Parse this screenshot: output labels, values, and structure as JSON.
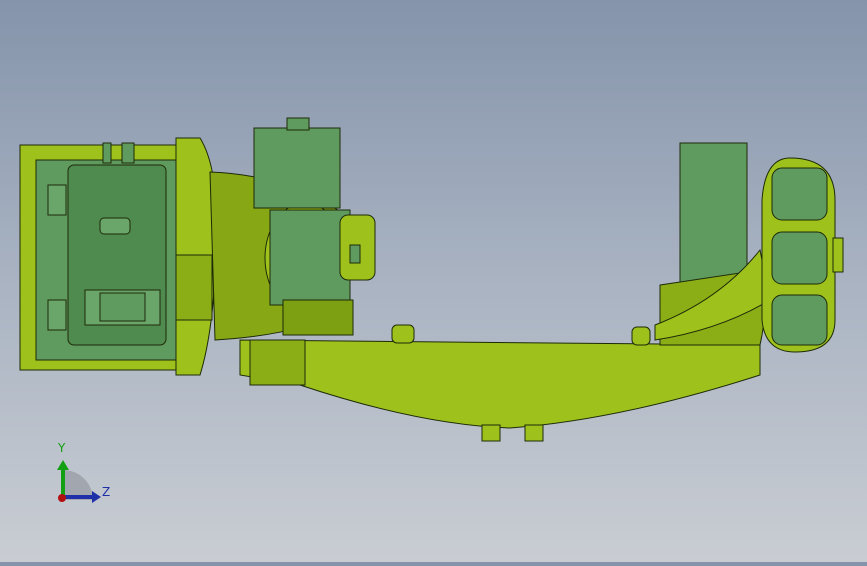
{
  "triad": {
    "y_label": "Y",
    "z_label": "Z"
  },
  "colors": {
    "body": "#9ec11c",
    "body_dark": "#6d8a12",
    "motor": "#5f9a5f",
    "edge": "#1e2a08",
    "y_axis": "#12a012",
    "z_axis": "#1f2fa8",
    "x_axis": "#b01010"
  }
}
